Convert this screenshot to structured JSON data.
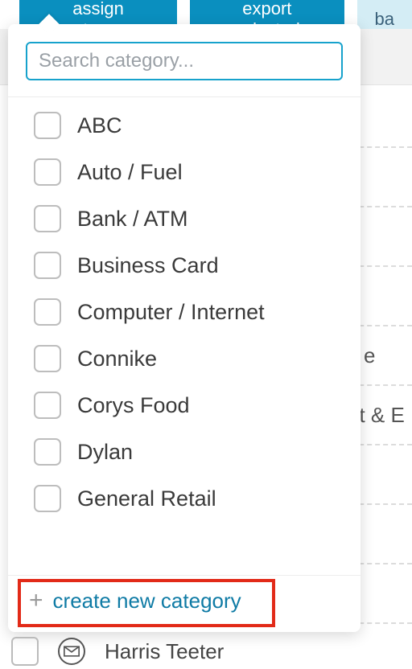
{
  "action_bar": {
    "assign_label": "assign category",
    "export_label": "export selected",
    "batch_label": "ba"
  },
  "dropdown": {
    "search_placeholder": "Search category...",
    "categories": [
      "ABC",
      "Auto / Fuel",
      "Bank / ATM",
      "Business Card",
      "Computer / Internet",
      "Connike",
      "Corys Food",
      "Dylan",
      "General Retail"
    ],
    "create_label": "create new category"
  },
  "background": {
    "rows": [
      "",
      "",
      "",
      "",
      "e",
      "nt & E",
      "",
      "",
      ""
    ]
  },
  "bottom_row": {
    "label": "Harris Teeter"
  }
}
